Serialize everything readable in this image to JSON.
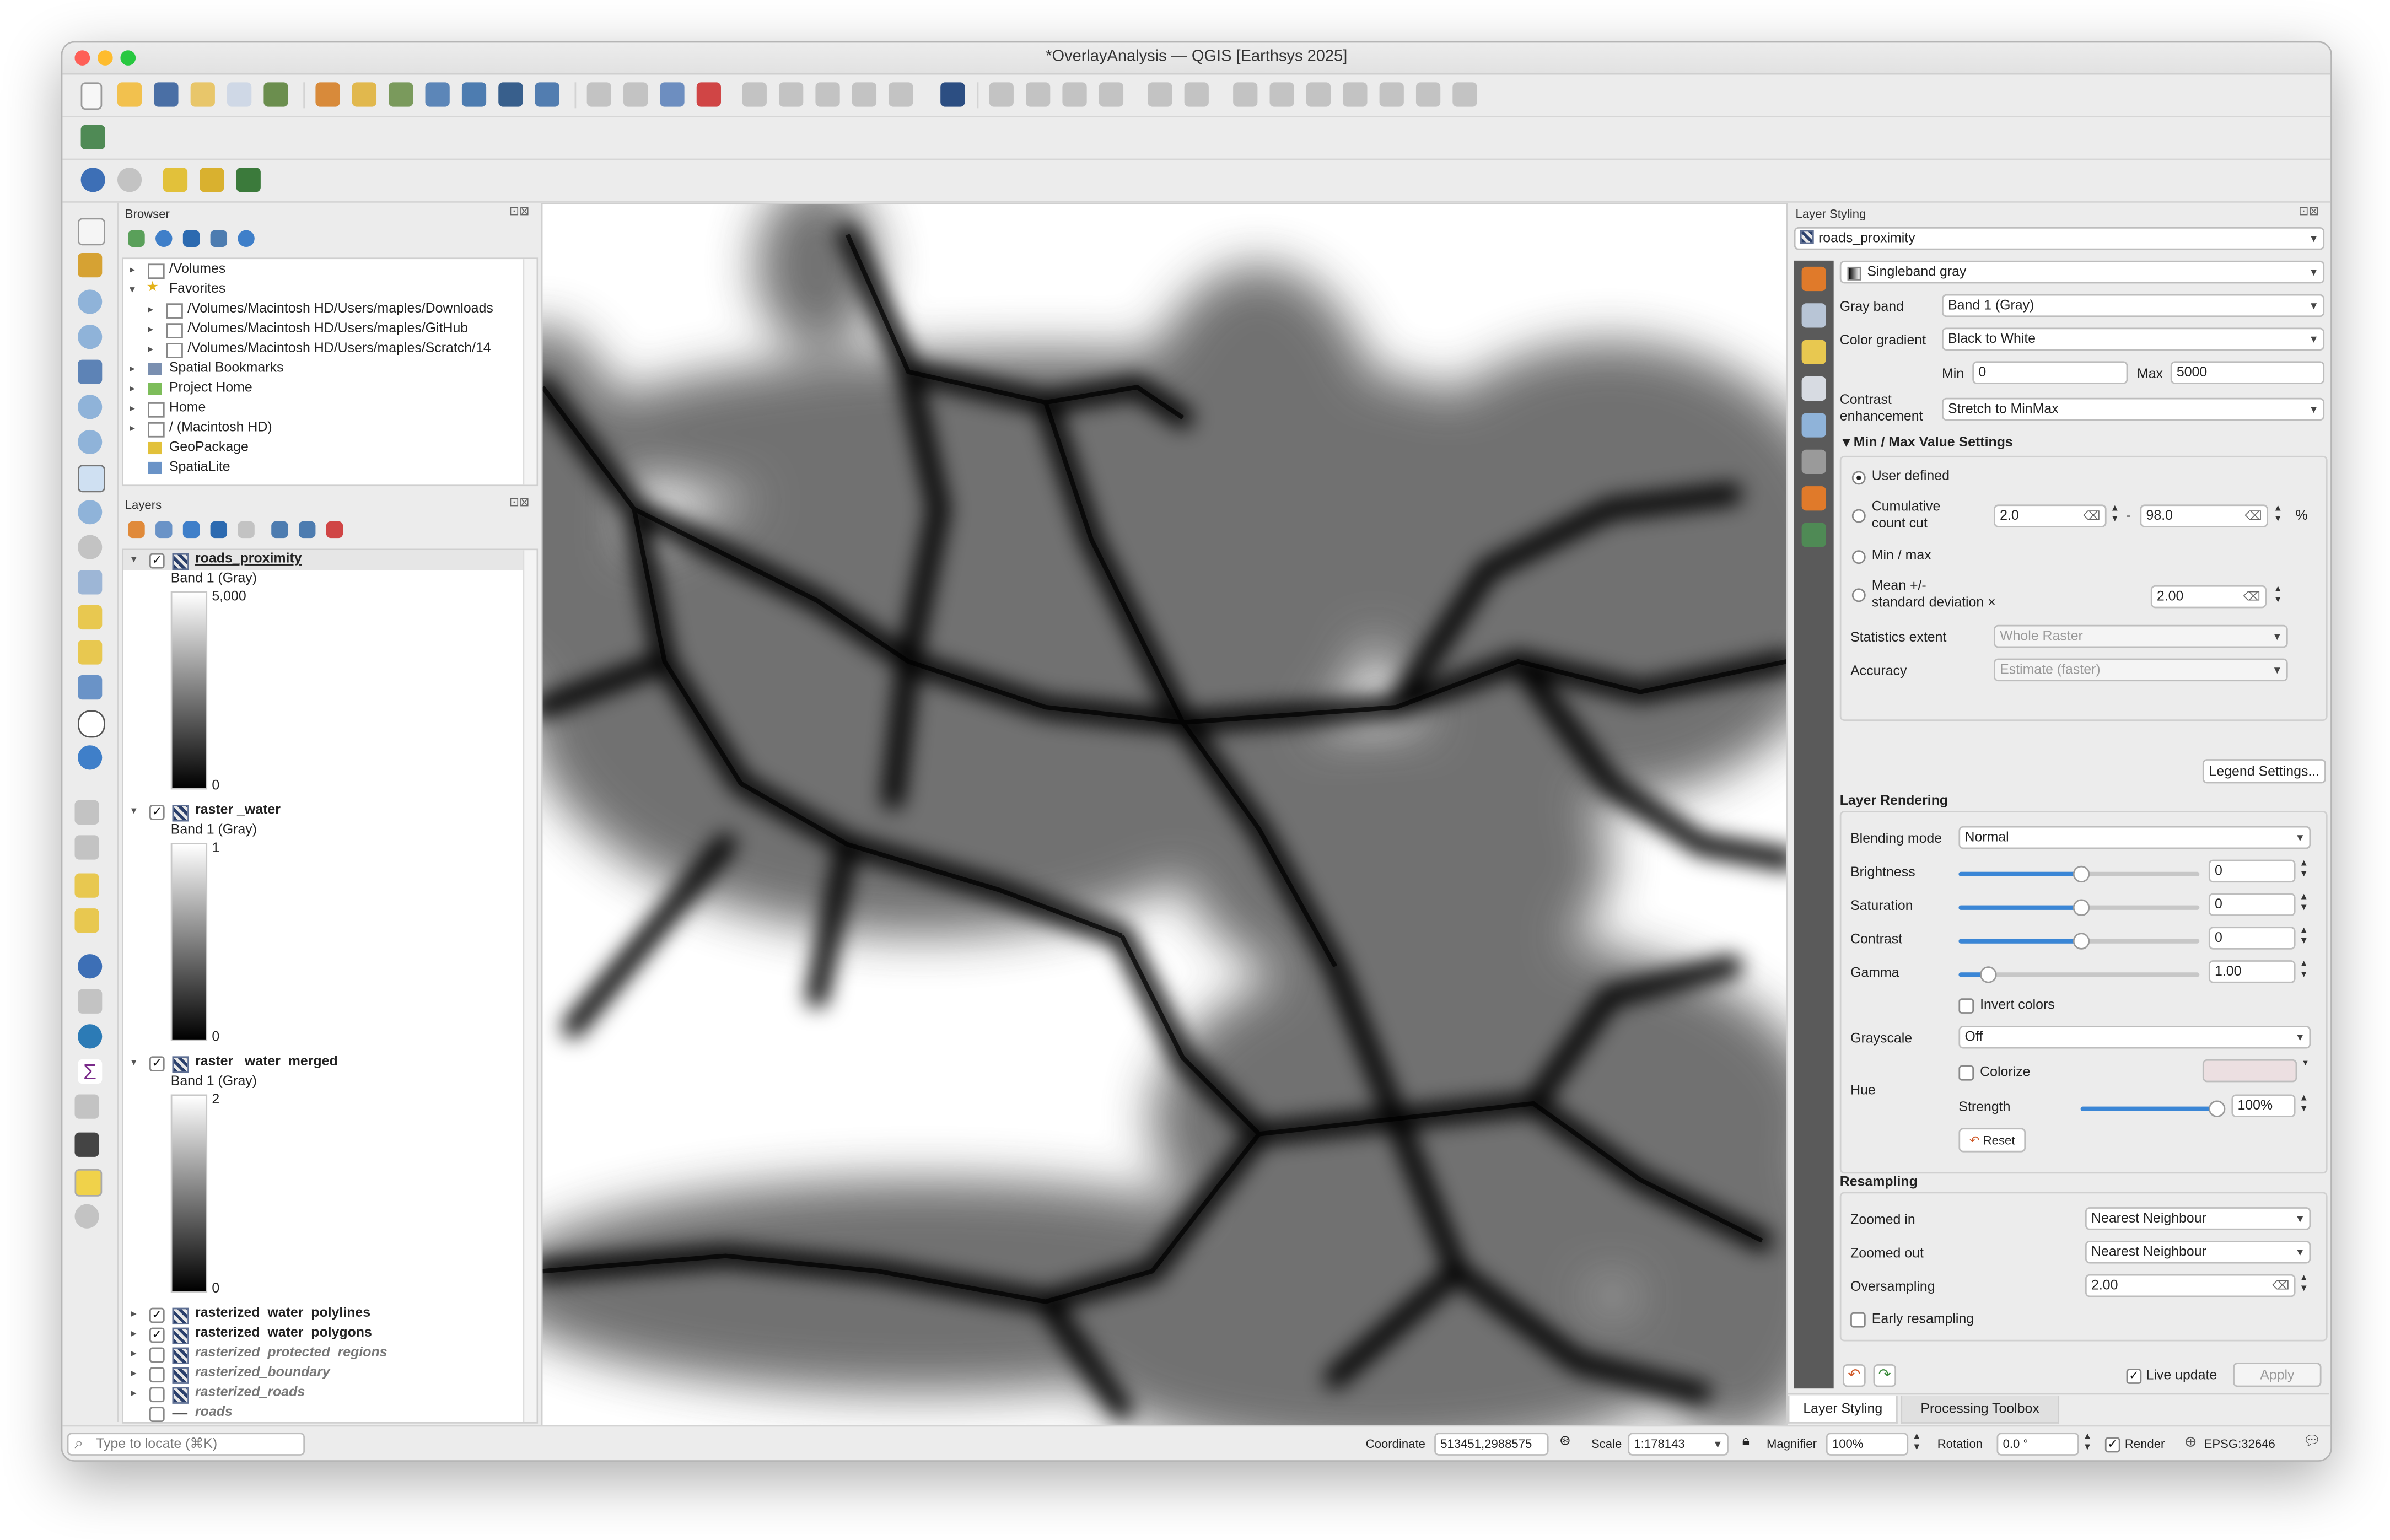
{
  "window": {
    "title": "*OverlayAnalysis — QGIS [Earthsys 2025]"
  },
  "colors": {
    "accent": "#3a86d6",
    "close": "#fe5f57",
    "minimize": "#febc2e",
    "zoom": "#28c840"
  },
  "browser": {
    "title": "Browser",
    "items": [
      {
        "label": "/Volumes"
      },
      {
        "label": "Favorites"
      },
      {
        "label": "/Volumes/Macintosh HD/Users/maples/Downloads"
      },
      {
        "label": "/Volumes/Macintosh HD/Users/maples/GitHub"
      },
      {
        "label": "/Volumes/Macintosh HD/Users/maples/Scratch/14"
      },
      {
        "label": "Spatial Bookmarks"
      },
      {
        "label": "Project Home"
      },
      {
        "label": "Home"
      },
      {
        "label": "/ (Macintosh HD)"
      },
      {
        "label": "GeoPackage"
      },
      {
        "label": "SpatiaLite"
      }
    ]
  },
  "layers": {
    "title": "Layers",
    "items": [
      {
        "name": "roads_proximity",
        "band": "Band 1 (Gray)",
        "max": "5,000",
        "min": "0"
      },
      {
        "name": "raster _water",
        "band": "Band 1 (Gray)",
        "max": "1",
        "min": "0"
      },
      {
        "name": "raster _water_merged",
        "band": "Band 1 (Gray)",
        "max": "2",
        "min": "0"
      },
      {
        "name": "rasterized_water_polylines"
      },
      {
        "name": "rasterized_water_polygons"
      },
      {
        "name": "rasterized_protected_regions"
      },
      {
        "name": "rasterized_boundary"
      },
      {
        "name": "rasterized_roads"
      },
      {
        "name": "roads"
      }
    ]
  },
  "styling": {
    "title": "Layer Styling",
    "layer": "roads_proximity",
    "renderer": "Singleband gray",
    "gray_band_label": "Gray band",
    "gray_band": "Band 1 (Gray)",
    "color_gradient_label": "Color gradient",
    "color_gradient": "Black to White",
    "min_label": "Min",
    "min": "0",
    "max_label": "Max",
    "max": "5000",
    "contrast_label_1": "Contrast",
    "contrast_label_2": "enhancement",
    "contrast": "Stretch to MinMax",
    "minmax_title": "Min / Max Value Settings",
    "user_defined": "User defined",
    "cumulative_1": "Cumulative",
    "cumulative_2": "count cut",
    "cum_low": "2.0",
    "cum_dash": "-",
    "cum_high": "98.0",
    "pct": "%",
    "minmax_opt": "Min / max",
    "mean_1": "Mean +/-",
    "mean_2": "standard deviation ×",
    "stddev": "2.00",
    "stats_extent_label": "Statistics extent",
    "stats_extent": "Whole Raster",
    "accuracy_label": "Accuracy",
    "accuracy": "Estimate (faster)",
    "legend_button": "Legend Settings...",
    "rendering_title": "Layer Rendering",
    "blending_label": "Blending mode",
    "blending": "Normal",
    "brightness_label": "Brightness",
    "brightness": "0",
    "saturation_label": "Saturation",
    "saturation": "0",
    "contrast2_label": "Contrast",
    "contrast2": "0",
    "gamma_label": "Gamma",
    "gamma": "1.00",
    "invert_label": "Invert colors",
    "grayscale_label": "Grayscale",
    "grayscale": "Off",
    "hue_label": "Hue",
    "colorize_label": "Colorize",
    "strength_label": "Strength",
    "strength": "100%",
    "reset_label": "Reset",
    "resampling_title": "Resampling",
    "zoomed_in_label": "Zoomed in",
    "zoomed_in": "Nearest Neighbour",
    "zoomed_out_label": "Zoomed out",
    "zoomed_out": "Nearest Neighbour",
    "oversampling_label": "Oversampling",
    "oversampling": "2.00",
    "early_label": "Early resampling",
    "live_update": "Live update",
    "apply": "Apply",
    "tab_styling": "Layer Styling",
    "tab_toolbox": "Processing Toolbox"
  },
  "statusbar": {
    "locate_placeholder": "Type to locate (⌘K)",
    "coordinate_label": "Coordinate",
    "coordinate": "513451,2988575",
    "scale_label": "Scale",
    "scale": "1:178143",
    "magnifier_label": "Magnifier",
    "magnifier": "100%",
    "rotation_label": "Rotation",
    "rotation": "0.0 °",
    "render_label": "Render",
    "crs": "EPSG:32646"
  }
}
